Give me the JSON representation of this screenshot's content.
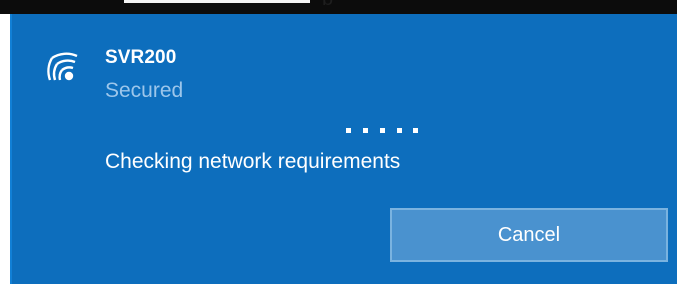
{
  "window": {
    "top_strip_label": "p"
  },
  "network": {
    "icon": "wifi-signal-icon",
    "name": "SVR200",
    "security": "Secured"
  },
  "connection": {
    "progress_indicator": "animated-dots",
    "status_message": "Checking network requirements"
  },
  "actions": {
    "cancel_label": "Cancel"
  },
  "colors": {
    "panel_background": "#0d6ebd",
    "secondary_text": "#9cc6eb",
    "button_background": "#4a92cf",
    "button_border": "#7ab3e0",
    "primary_text": "#ffffff"
  }
}
